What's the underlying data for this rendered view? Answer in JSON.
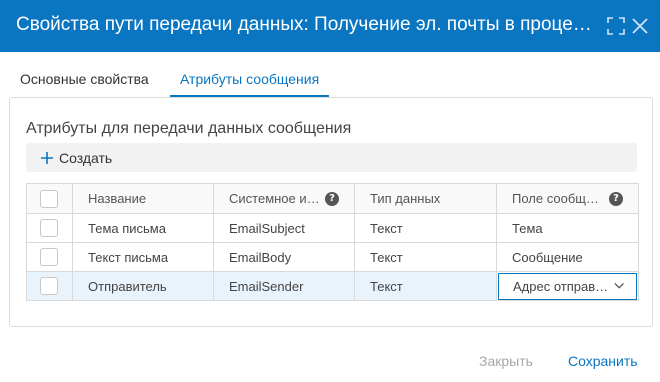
{
  "dialog": {
    "title": "Свойства пути передачи данных: Получение эл. почты в процессе",
    "maximize_icon": "expand-icon",
    "close_icon": "close-icon"
  },
  "tabs": [
    {
      "label": "Основные свойства",
      "active": false
    },
    {
      "label": "Атрибуты сообщения",
      "active": true
    }
  ],
  "section": {
    "title": "Атрибуты для передачи данных сообщения",
    "create_label": "Создать"
  },
  "table": {
    "headers": {
      "name": "Название",
      "system_name": "Системное имя",
      "data_type": "Тип данных",
      "message_field": "Поле сообщения"
    },
    "rows": [
      {
        "name": "Тема письма",
        "system_name": "EmailSubject",
        "data_type": "Текст",
        "message_field": "Тема"
      },
      {
        "name": "Текст письма",
        "system_name": "EmailBody",
        "data_type": "Текст",
        "message_field": "Сообщение"
      },
      {
        "name": "Отправитель",
        "system_name": "EmailSender",
        "data_type": "Текст",
        "message_field": "Адрес отправителя"
      }
    ]
  },
  "footer": {
    "close_label": "Закрыть",
    "save_label": "Сохранить"
  },
  "colors": {
    "accent": "#0a76c2",
    "selected_row": "#e9f3fc"
  }
}
